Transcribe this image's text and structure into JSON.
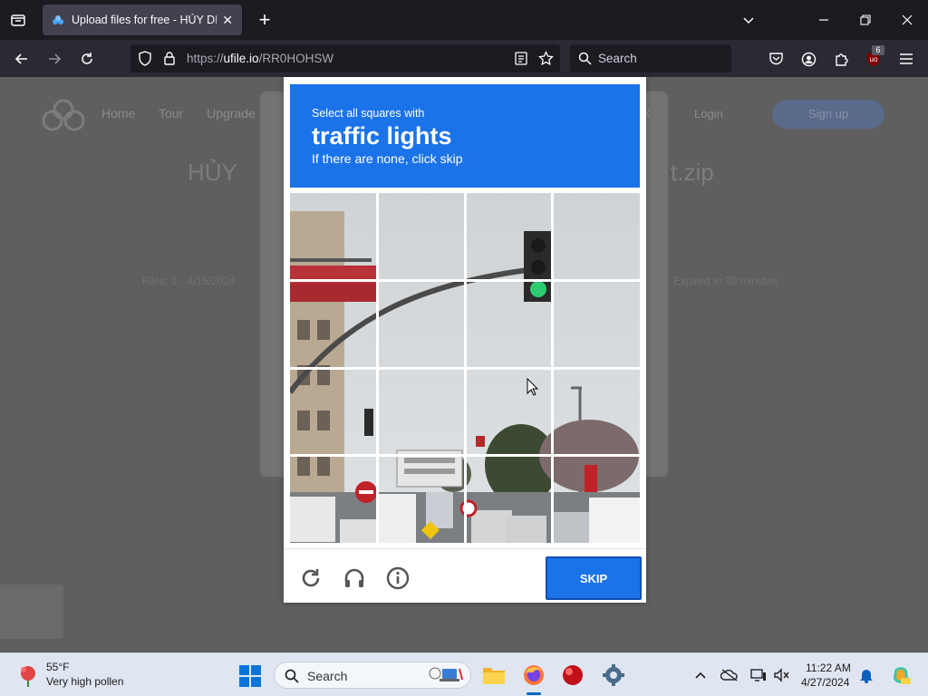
{
  "browser": {
    "tab_title": "Upload files for free - HỦY DIỆT",
    "url_prefix": "https://",
    "url_domain": "ufile.io",
    "url_path": "/RR0HOHSW",
    "search_placeholder": "Search",
    "extension_badge": "6"
  },
  "page": {
    "nav_items": [
      "Home",
      "Tour",
      "Upgrade"
    ],
    "login": "Login",
    "signup": "Sign up",
    "heading_left": "HỦY",
    "heading_right": "t.zip",
    "meta_left": "Files: 1 · 4/16/2024",
    "meta_right": "Expired in 30 minutes",
    "modal_close": "×"
  },
  "captcha": {
    "instruction_line1": "Select all squares with",
    "instruction_target": "traffic lights",
    "instruction_line3": "If there are none, click skip",
    "skip_label": "SKIP",
    "reload_icon": "reload-icon",
    "audio_icon": "headphones-icon",
    "info_icon": "info-icon",
    "grid_size": 4
  },
  "taskbar": {
    "weather_temp": "55°F",
    "weather_desc": "Very high pollen",
    "search_label": "Search",
    "clock_time": "11:22 AM",
    "clock_date": "4/27/2024"
  }
}
